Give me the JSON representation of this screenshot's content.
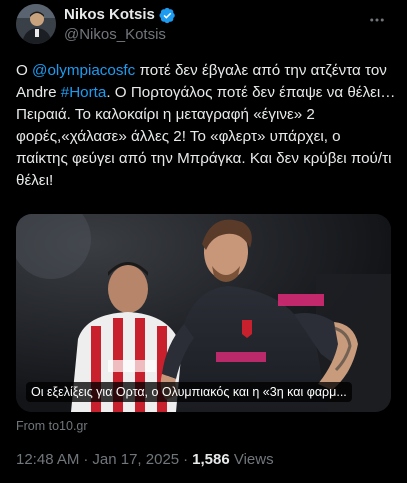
{
  "author": {
    "display_name": "Nikos Kotsis",
    "handle": "@Nikos_Kotsis"
  },
  "colors": {
    "background": "#000000",
    "text": "#e7e9ea",
    "secondary": "#71767b",
    "link": "#1d9bf0",
    "verified": "#1d9bf0"
  },
  "icons": {
    "verified": "verified-badge-icon",
    "more": "more-options-icon"
  },
  "tweet": {
    "segments": [
      {
        "text": "Ο ",
        "type": "text"
      },
      {
        "text": "@olympiacosfc",
        "type": "link"
      },
      {
        "text": " ποτέ δεν έβγαλε από την ατζέντα τον Andre ",
        "type": "text"
      },
      {
        "text": "#Horta",
        "type": "link"
      },
      {
        "text": ". Ο Πορτογάλος ποτέ δεν έπαψε να θέλει…Πειραιά. Το καλοκαίρι η μεταγραφή «έγινε» 2 φορές,«χάλασε» άλλες 2! Το «φλερτ» υπάρχει, ο παίκτης φεύγει από την Μπράγκα. Και δεν κρύβει πού/τι θέλει!",
        "type": "text"
      }
    ]
  },
  "card": {
    "caption": "Οι εξελίξεις για Ορτα, ο Ολυμπιακός και η «3η και φαρμ...",
    "source": "From to10.gr"
  },
  "meta": {
    "time": "12:48 AM",
    "separator": "·",
    "date": "Jan 17, 2025",
    "views_count": "1,586",
    "views_label": "Views"
  }
}
